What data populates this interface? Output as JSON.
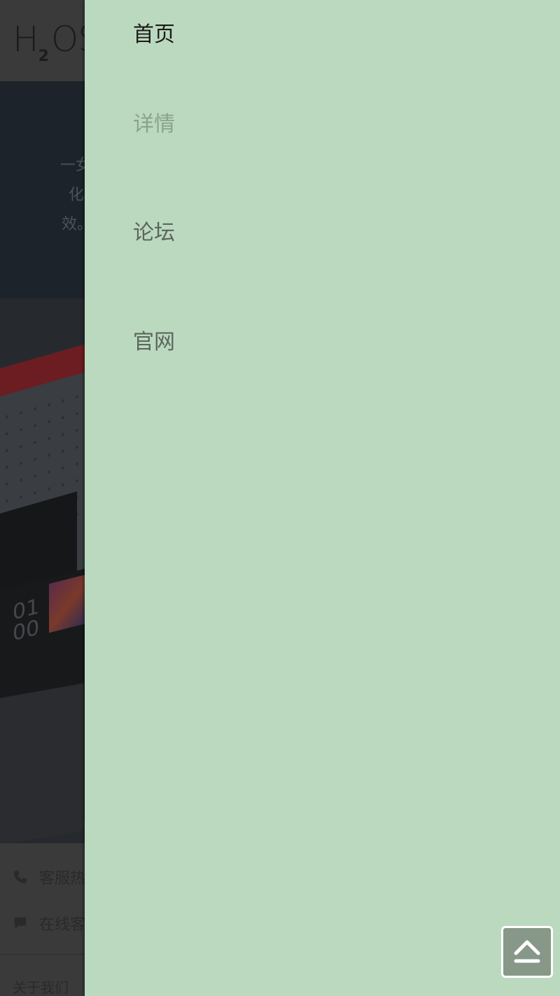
{
  "background_page": {
    "logo_text": "H",
    "logo_subscript": "2",
    "logo_suffix": "OS",
    "hero_lines": [
      "一女",
      "化",
      "效。"
    ],
    "device_clock": "01\n00",
    "footer": {
      "service_label": "客服热",
      "chat_label": "在线客",
      "about_label": "关于我们"
    }
  },
  "drawer": {
    "items": [
      {
        "label": "首页",
        "state": "active"
      },
      {
        "label": "详情",
        "state": "muted"
      },
      {
        "label": "论坛",
        "state": "normal"
      },
      {
        "label": "官网",
        "state": "normal"
      }
    ]
  },
  "back_to_top": {
    "icon": "chevron-up-icon"
  },
  "colors": {
    "drawer_bg": "#bbd9bf",
    "active_text": "#1b1b1b",
    "muted_text": "#8aa38d",
    "normal_text": "#5d665e"
  }
}
